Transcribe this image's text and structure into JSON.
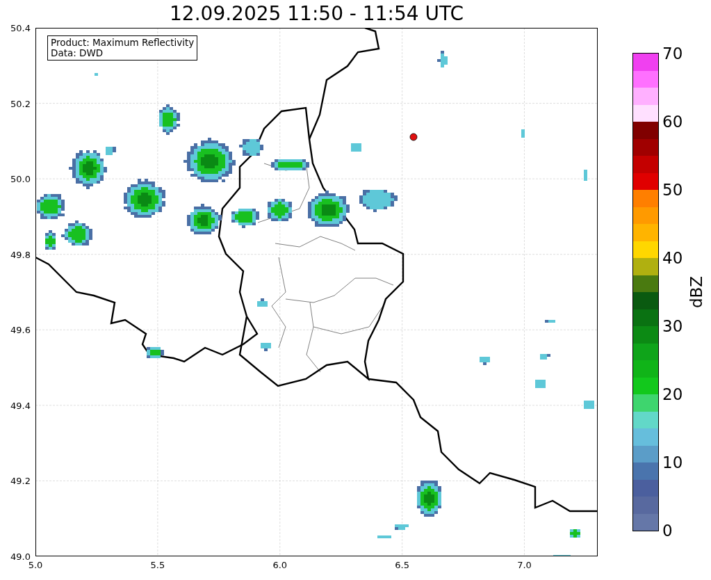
{
  "title": "12.09.2025 11:50 - 11:54 UTC",
  "info_box": [
    "Product: Maximum Reflectivity",
    "Data: DWD"
  ],
  "x_ticks": [
    "5.0",
    "5.5",
    "6.0",
    "6.5",
    "7.0"
  ],
  "y_ticks": [
    "50.4",
    "50.2",
    "50.0",
    "49.8",
    "49.6",
    "49.4",
    "49.2",
    "49.0"
  ],
  "colorbar": {
    "label": "dBZ",
    "ticks": [
      "70",
      "60",
      "50",
      "40",
      "30",
      "20",
      "10",
      "0"
    ],
    "segments": [
      {
        "color": "#6577a8"
      },
      {
        "color": "#58699f"
      },
      {
        "color": "#4b5f9e"
      },
      {
        "color": "#4a74ad"
      },
      {
        "color": "#5b9dc8"
      },
      {
        "color": "#66bedc"
      },
      {
        "color": "#62d8c8"
      },
      {
        "color": "#3ed56e"
      },
      {
        "color": "#12c81c"
      },
      {
        "color": "#10b418"
      },
      {
        "color": "#0fa41a"
      },
      {
        "color": "#0c8a14"
      },
      {
        "color": "#0a7212"
      },
      {
        "color": "#0a5a10"
      },
      {
        "color": "#4a7a10"
      },
      {
        "color": "#b0b010"
      },
      {
        "color": "#ffd700"
      },
      {
        "color": "#ffb400"
      },
      {
        "color": "#ff9a00"
      },
      {
        "color": "#ff7f00"
      },
      {
        "color": "#e00000"
      },
      {
        "color": "#c40000"
      },
      {
        "color": "#a00000"
      },
      {
        "color": "#800000"
      },
      {
        "color": "#ffe0ff"
      },
      {
        "color": "#ffb0ff"
      },
      {
        "color": "#ff70ff"
      },
      {
        "color": "#f040f0"
      }
    ]
  }
}
